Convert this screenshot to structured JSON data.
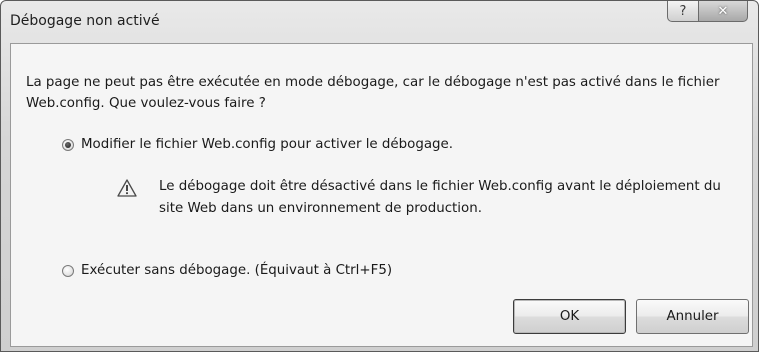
{
  "window": {
    "title": "Débogage non activé"
  },
  "titlebar_buttons": {
    "help": "?",
    "close": "✕"
  },
  "dialog": {
    "message": "La page ne peut pas être exécutée en mode débogage, car le débogage n'est pas activé dans le fichier Web.config. Que voulez-vous faire ?",
    "options": [
      {
        "label": "Modifier le fichier Web.config pour activer le débogage.",
        "selected": true
      },
      {
        "label": "Exécuter sans débogage. (Équivaut à Ctrl+F5)",
        "selected": false
      }
    ],
    "warning": {
      "icon": "warning-triangle-icon",
      "text": "Le débogage doit être désactivé dans le fichier Web.config avant le déploiement du site Web dans un environnement de production."
    },
    "buttons": {
      "ok": "OK",
      "cancel": "Annuler"
    }
  }
}
